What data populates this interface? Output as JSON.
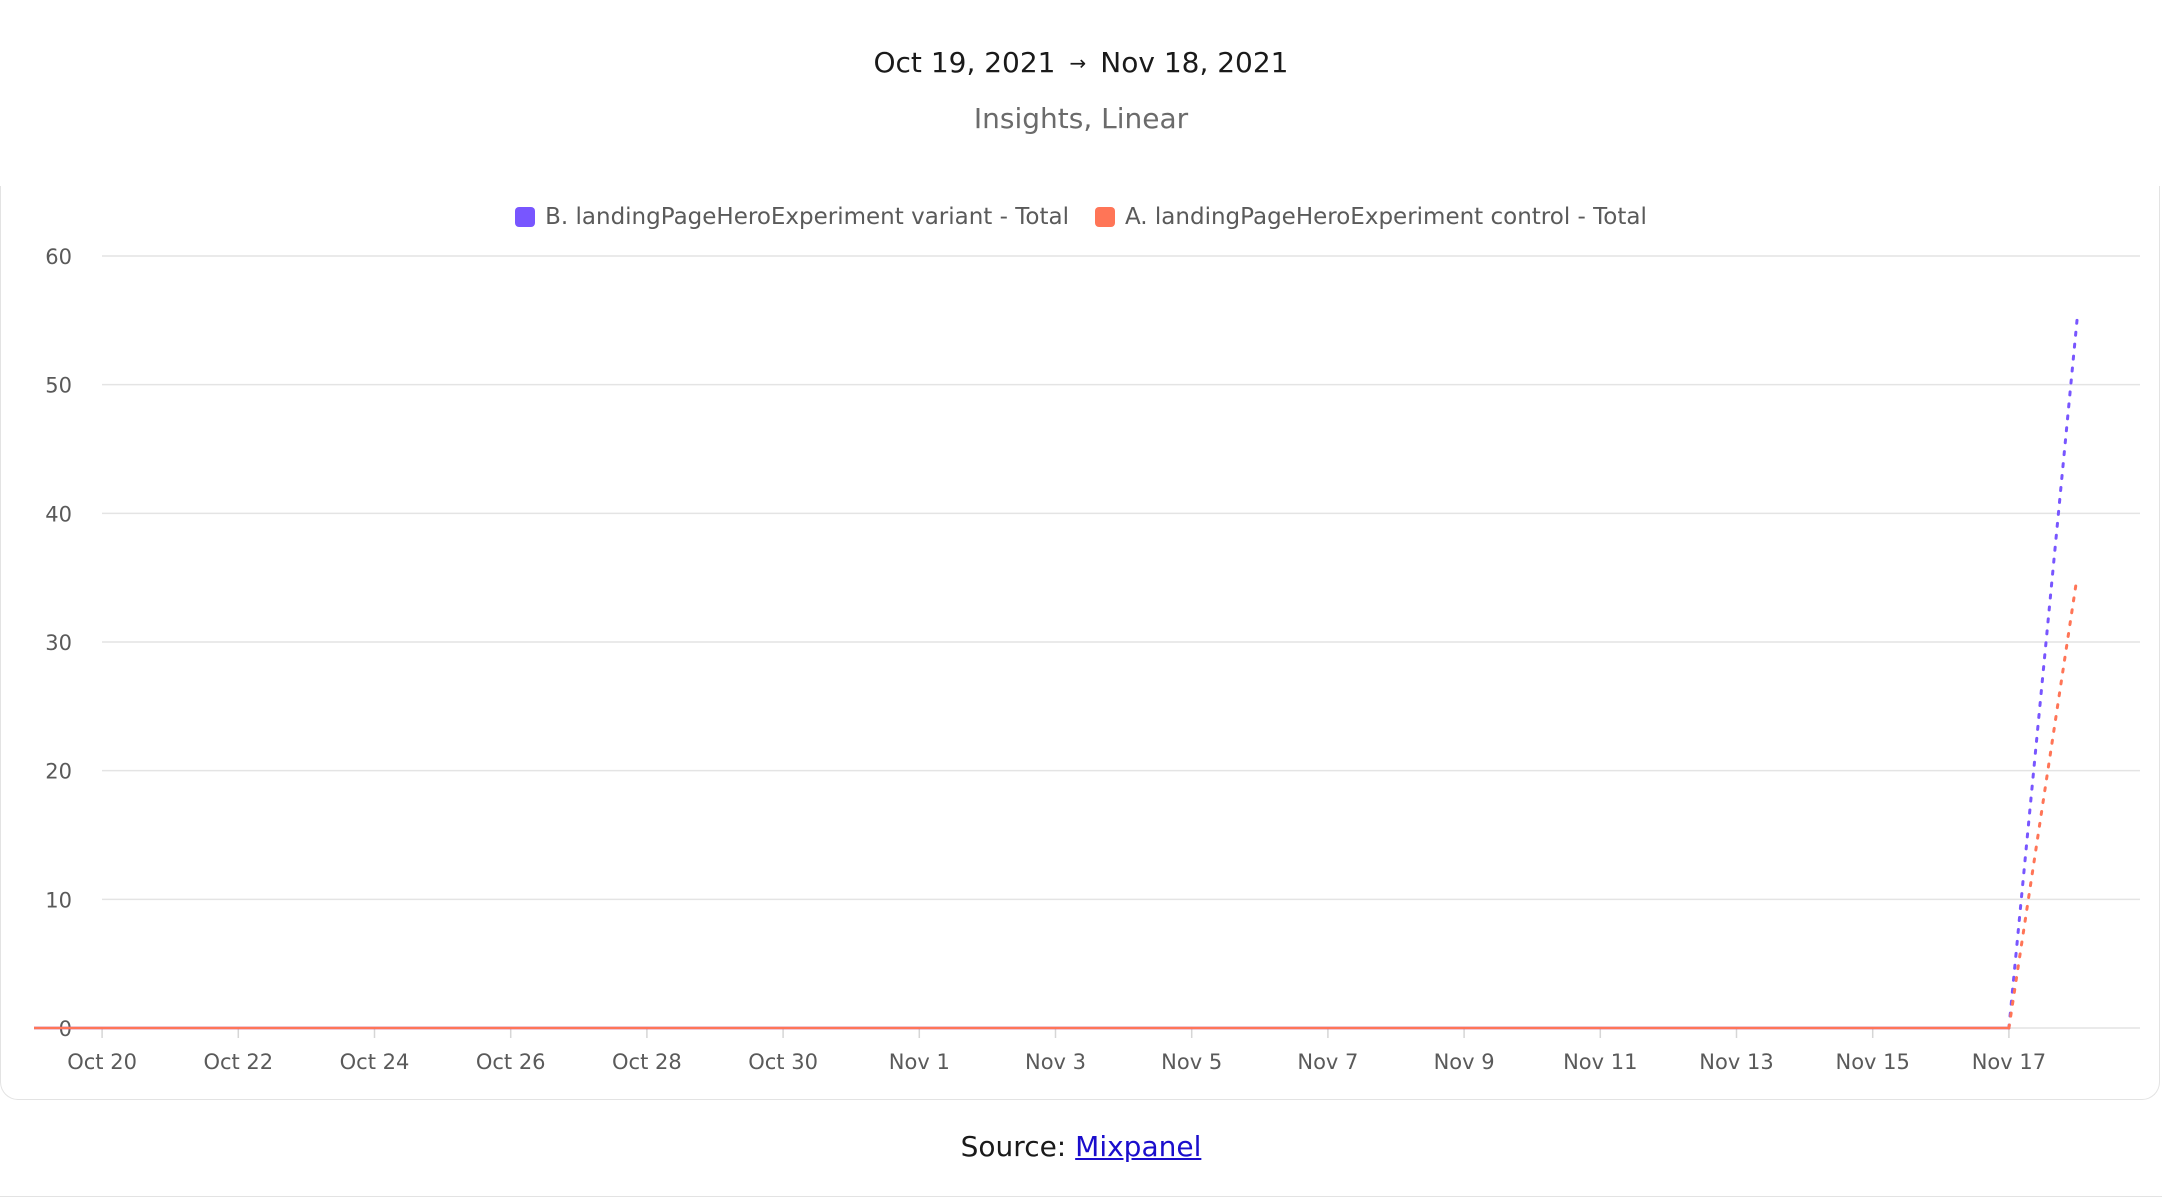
{
  "header": {
    "date_start": "Oct 19, 2021",
    "date_arrow": "→",
    "date_end": "Nov 18, 2021",
    "subtitle": "Insights, Linear"
  },
  "source": {
    "prefix": "Source: ",
    "link_text": "Mixpanel"
  },
  "chart_data": {
    "type": "line",
    "x": [
      "Oct 19",
      "Oct 20",
      "Oct 21",
      "Oct 22",
      "Oct 23",
      "Oct 24",
      "Oct 25",
      "Oct 26",
      "Oct 27",
      "Oct 28",
      "Oct 29",
      "Oct 30",
      "Oct 31",
      "Nov 1",
      "Nov 2",
      "Nov 3",
      "Nov 4",
      "Nov 5",
      "Nov 6",
      "Nov 7",
      "Nov 8",
      "Nov 9",
      "Nov 10",
      "Nov 11",
      "Nov 12",
      "Nov 13",
      "Nov 14",
      "Nov 15",
      "Nov 16",
      "Nov 17",
      "Nov 18"
    ],
    "x_ticks": [
      "Oct 20",
      "Oct 22",
      "Oct 24",
      "Oct 26",
      "Oct 28",
      "Oct 30",
      "Nov 1",
      "Nov 3",
      "Nov 5",
      "Nov 7",
      "Nov 9",
      "Nov 11",
      "Nov 13",
      "Nov 15",
      "Nov 17"
    ],
    "y_ticks": [
      0,
      10,
      20,
      30,
      40,
      50,
      60
    ],
    "ylim": [
      0,
      60
    ],
    "grid": true,
    "legend_placement": "top-center",
    "series": [
      {
        "name": "B. landingPageHeroExperiment variant - Total",
        "color": "#7856ff",
        "values": [
          0,
          0,
          0,
          0,
          0,
          0,
          0,
          0,
          0,
          0,
          0,
          0,
          0,
          0,
          0,
          0,
          0,
          0,
          0,
          0,
          0,
          0,
          0,
          0,
          0,
          0,
          0,
          0,
          0,
          0,
          55
        ],
        "last_segment_dotted": true
      },
      {
        "name": "A. landingPageHeroExperiment control - Total",
        "color": "#ff7557",
        "values": [
          0,
          0,
          0,
          0,
          0,
          0,
          0,
          0,
          0,
          0,
          0,
          0,
          0,
          0,
          0,
          0,
          0,
          0,
          0,
          0,
          0,
          0,
          0,
          0,
          0,
          0,
          0,
          0,
          0,
          0,
          35
        ],
        "last_segment_dotted": true
      }
    ]
  }
}
